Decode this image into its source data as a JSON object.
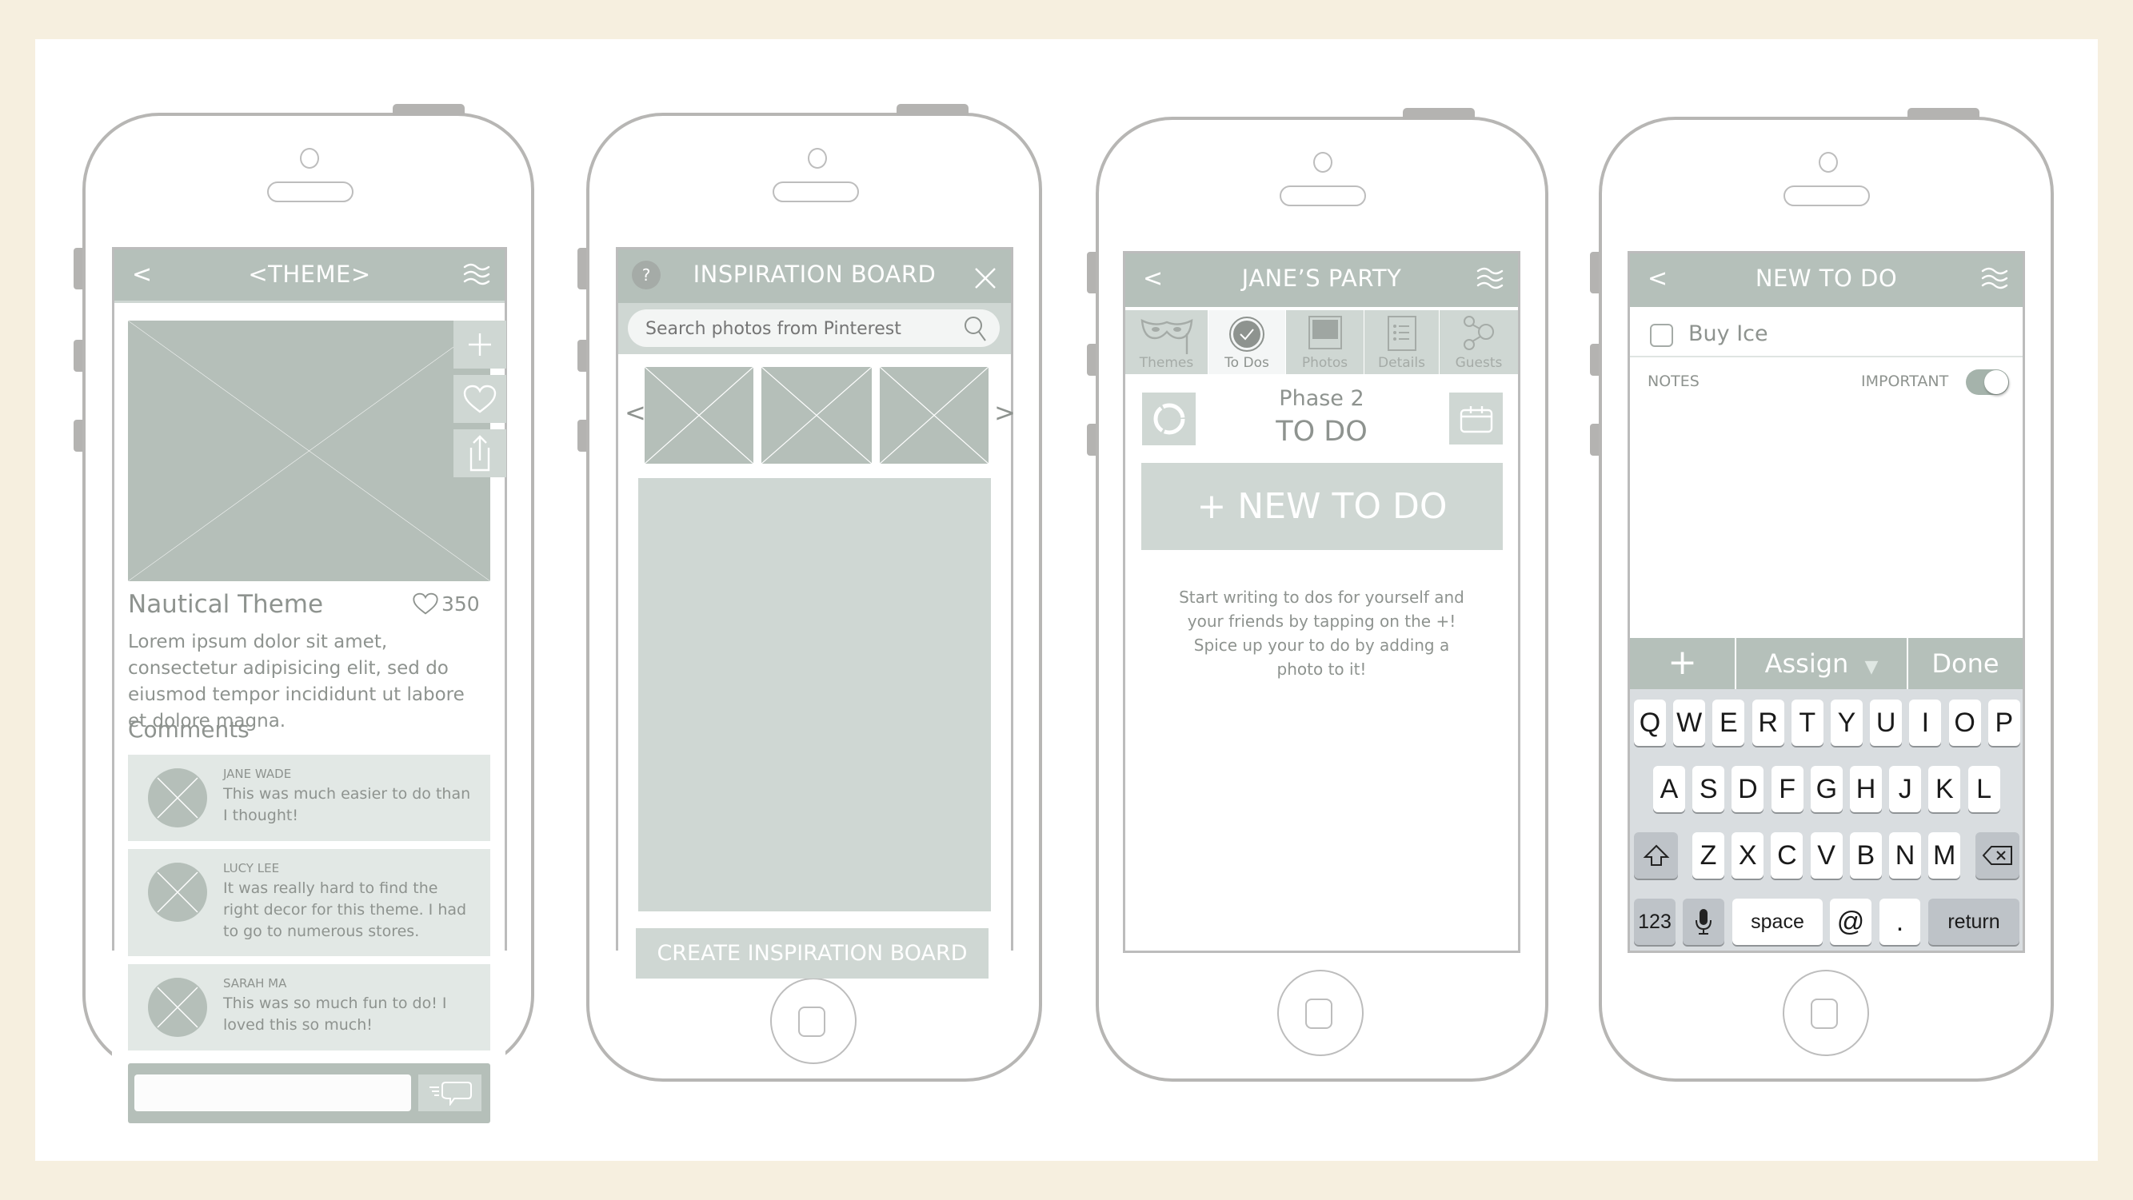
{
  "colors": {
    "background": "#f6efdf",
    "card": "#ffffff",
    "accent": "#b5c0ba",
    "accent_light": "#cfd7d3",
    "frame": "#b7b6b4",
    "text_gray": "#8e938f"
  },
  "phones": [
    {
      "screen": "theme-detail",
      "navbar": {
        "back_icon": "chevron-left-icon",
        "back": "<",
        "title": "<THEME>",
        "menu_icon": "waves-menu-icon"
      },
      "hero_image": {
        "icon": "image-placeholder-icon"
      },
      "side_actions": [
        {
          "icon": "plus-icon",
          "label": "Add"
        },
        {
          "icon": "heart-icon",
          "label": "Like"
        },
        {
          "icon": "share-icon",
          "label": "Share"
        }
      ],
      "theme_title": "Nautical Theme",
      "likes": {
        "icon": "heart-outline-icon",
        "count": "350"
      },
      "description": "Lorem ipsum dolor sit amet, consectetur adipisicing elit, sed do eiusmod tempor incididunt ut labore et dolore magna.",
      "comments_heading": "Comments",
      "comments": [
        {
          "name": "JANE WADE",
          "text": "This was much easier to do than I thought!"
        },
        {
          "name": "LUCY LEE",
          "text": "It was really hard to find the right decor for this theme. I had to go to numerous stores."
        },
        {
          "name": "SARAH MA",
          "text": "This was so much fun to do! I loved this so much!"
        }
      ],
      "comment_input": {
        "value": "",
        "placeholder": "",
        "send_icon": "send-comment-icon"
      }
    },
    {
      "screen": "inspiration-board",
      "navbar": {
        "help_icon": "help-icon",
        "help": "?",
        "title": "INSPIRATION BOARD",
        "close_icon": "close-icon"
      },
      "search": {
        "placeholder": "Search photos from Pinterest",
        "value": "",
        "icon": "search-icon"
      },
      "carousel": {
        "prev": "<",
        "next": ">",
        "thumbnail_count": 3
      },
      "create_button": "CREATE INSPIRATION BOARD"
    },
    {
      "screen": "party-todos",
      "navbar": {
        "back": "<",
        "title": "JANE’S PARTY",
        "menu_icon": "waves-menu-icon"
      },
      "tabs": [
        {
          "label": "Themes",
          "icon": "mask-icon",
          "active": false
        },
        {
          "label": "To Dos",
          "icon": "check-circle-icon",
          "active": true
        },
        {
          "label": "Photos",
          "icon": "photo-icon",
          "active": false
        },
        {
          "label": "Details",
          "icon": "list-icon",
          "active": false
        },
        {
          "label": "Guests",
          "icon": "share-nodes-icon",
          "active": false
        }
      ],
      "phase": "Phase 2",
      "section_title": "TO DO",
      "new_todo_button": "+ NEW TO DO",
      "empty_hint": "Start writing to dos for yourself and your friends by tapping on the +! Spice up your to do by adding a photo to it!"
    },
    {
      "screen": "new-todo",
      "navbar": {
        "back": "<",
        "title": "NEW TO DO",
        "menu_icon": "waves-menu-icon"
      },
      "todo_item": {
        "text": "Buy Ice",
        "checked": false
      },
      "notes_label": "NOTES",
      "important_label": "IMPORTANT",
      "important_on": true,
      "toolbar": {
        "add": "+",
        "assign": "Assign",
        "assign_caret": "▼",
        "done": "Done"
      },
      "keyboard": {
        "row1": [
          "Q",
          "W",
          "E",
          "R",
          "T",
          "Y",
          "U",
          "I",
          "O",
          "P"
        ],
        "row2": [
          "A",
          "S",
          "D",
          "F",
          "G",
          "H",
          "J",
          "K",
          "L"
        ],
        "row3": [
          "Z",
          "X",
          "C",
          "V",
          "B",
          "N",
          "M"
        ],
        "shift_icon": "shift-icon",
        "delete_icon": "backspace-icon",
        "numbers": "123",
        "mic_icon": "microphone-icon",
        "space": "space",
        "at": "@",
        "period": ".",
        "return": "return"
      }
    }
  ]
}
